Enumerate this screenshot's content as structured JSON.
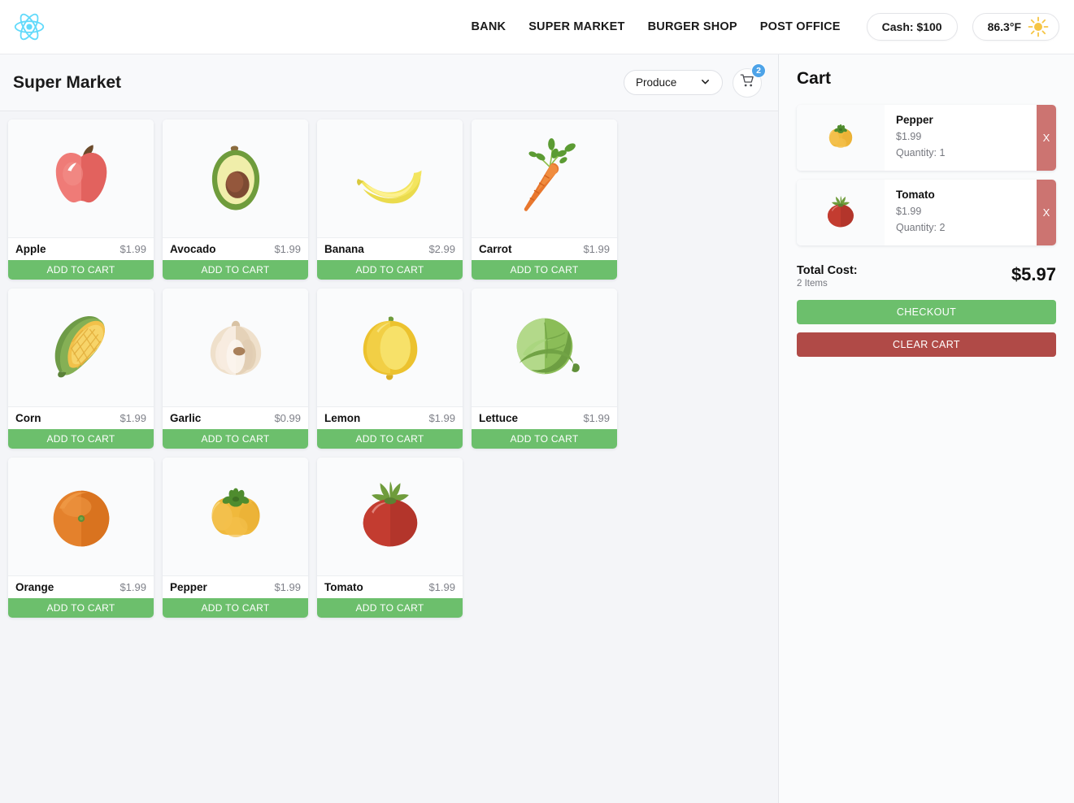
{
  "nav": {
    "logo_icon": "react-logo-icon",
    "links": [
      {
        "label": "BANK"
      },
      {
        "label": "SUPER MARKET"
      },
      {
        "label": "BURGER SHOP"
      },
      {
        "label": "POST OFFICE"
      }
    ],
    "cash": "Cash: $100",
    "weather": "86.3°F",
    "weather_icon": "sun-icon"
  },
  "main": {
    "title": "Super Market",
    "category_selected": "Produce",
    "category_options": [
      "Produce"
    ],
    "cart_count": "2"
  },
  "products": [
    {
      "name": "Apple",
      "price": "$1.99",
      "icon": "apple-icon",
      "add_label": "ADD TO CART"
    },
    {
      "name": "Avocado",
      "price": "$1.99",
      "icon": "avocado-icon",
      "add_label": "ADD TO CART"
    },
    {
      "name": "Banana",
      "price": "$2.99",
      "icon": "banana-icon",
      "add_label": "ADD TO CART"
    },
    {
      "name": "Carrot",
      "price": "$1.99",
      "icon": "carrot-icon",
      "add_label": "ADD TO CART"
    },
    {
      "name": "Corn",
      "price": "$1.99",
      "icon": "corn-icon",
      "add_label": "ADD TO CART"
    },
    {
      "name": "Garlic",
      "price": "$0.99",
      "icon": "garlic-icon",
      "add_label": "ADD TO CART"
    },
    {
      "name": "Lemon",
      "price": "$1.99",
      "icon": "lemon-icon",
      "add_label": "ADD TO CART"
    },
    {
      "name": "Lettuce",
      "price": "$1.99",
      "icon": "lettuce-icon",
      "add_label": "ADD TO CART"
    },
    {
      "name": "Orange",
      "price": "$1.99",
      "icon": "orange-icon",
      "add_label": "ADD TO CART"
    },
    {
      "name": "Pepper",
      "price": "$1.99",
      "icon": "pepper-icon",
      "add_label": "ADD TO CART"
    },
    {
      "name": "Tomato",
      "price": "$1.99",
      "icon": "tomato-icon",
      "add_label": "ADD TO CART"
    }
  ],
  "cart": {
    "title": "Cart",
    "items": [
      {
        "name": "Pepper",
        "price": "$1.99",
        "quantity": "Quantity: 1",
        "icon": "pepper-icon",
        "remove_label": "X"
      },
      {
        "name": "Tomato",
        "price": "$1.99",
        "quantity": "Quantity: 2",
        "icon": "tomato-icon",
        "remove_label": "X"
      }
    ],
    "total_label": "Total Cost:",
    "item_count": "2 Items",
    "total_amount": "$5.97",
    "checkout_label": "CHECKOUT",
    "clear_label": "CLEAR CART"
  },
  "colors": {
    "green": "#6cbf6c",
    "red": "#b04a47",
    "remove_red": "#cc7471",
    "badge_blue": "#4da3e8",
    "react_blue": "#61dafb",
    "sun_yellow": "#f6c544"
  }
}
